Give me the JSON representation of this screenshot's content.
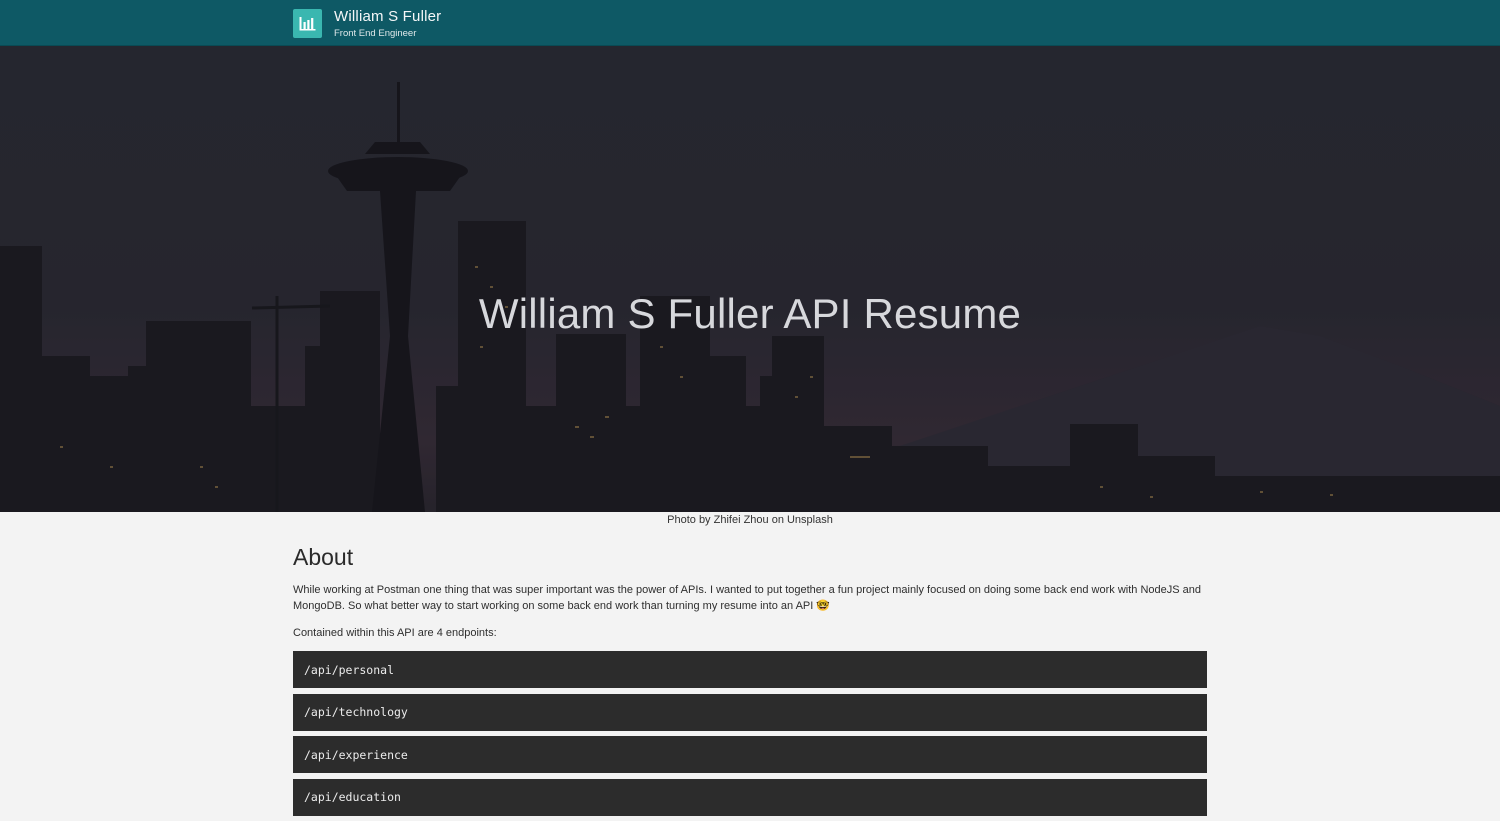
{
  "header": {
    "title": "William S Fuller",
    "subtitle": "Front End Engineer",
    "logo_icon": "bar-chart-logo-icon",
    "background": "#0e5965",
    "logo_color": "#3ab7b0"
  },
  "hero": {
    "title": "William S Fuller API Resume",
    "image_subject": "seattle-skyline-night-photo"
  },
  "photo_credit": "Photo by Zhifei Zhou on Unsplash",
  "about": {
    "heading": "About",
    "paragraph": "While working at Postman one thing that was super important was the power of APIs. I wanted to put together a fun project mainly focused on doing some back end work with NodeJS and MongoDB. So what better way to start working on some back end work than turning my resume into an API 🤓",
    "contained": "Contained within this API are 4 endpoints:"
  },
  "endpoints": [
    "/api/personal",
    "/api/technology",
    "/api/experience",
    "/api/education"
  ]
}
